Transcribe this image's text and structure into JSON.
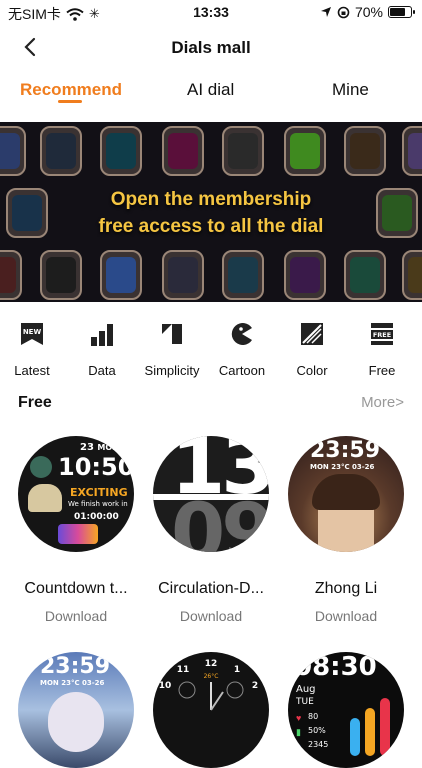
{
  "status_bar": {
    "carrier": "无SIM卡",
    "time": "13:33",
    "battery": "70%"
  },
  "nav": {
    "title": "Dials mall"
  },
  "tabs": [
    {
      "label": "Recommend"
    },
    {
      "label": "AI dial"
    },
    {
      "label": "Mine"
    }
  ],
  "banner": {
    "line1": "Open the membership",
    "line2": "free access to all the dial"
  },
  "categories": [
    {
      "label": "Latest",
      "icon_text": "NEW"
    },
    {
      "label": "Data"
    },
    {
      "label": "Simplicity"
    },
    {
      "label": "Cartoon"
    },
    {
      "label": "Color"
    },
    {
      "label": "Free",
      "icon_text": "FREE"
    }
  ],
  "section": {
    "title": "Free",
    "more": "More>"
  },
  "dials": [
    {
      "name": "Countdown t...",
      "action": "Download",
      "time": "10:50",
      "day": "23",
      "mon": "MON",
      "text1": "EXCITING",
      "text2": "We finish work in",
      "text3": "01:00:00"
    },
    {
      "name": "Circulation-D...",
      "action": "Download",
      "hour": "13",
      "min": "09"
    },
    {
      "name": "Zhong Li",
      "action": "Download",
      "time": "23:59",
      "date": "MON 23°C 03-26"
    },
    {
      "time": "23:59",
      "date": "MON 23°C 03-26"
    },
    {
      "temp": "26°C"
    },
    {
      "time": "08:30",
      "mon": "Aug",
      "dow": "TUE",
      "hr": "80",
      "pct": "50%",
      "steps": "2345"
    }
  ],
  "colors": {
    "accent": "#f07d1e",
    "banner_text": "#f5c542"
  }
}
